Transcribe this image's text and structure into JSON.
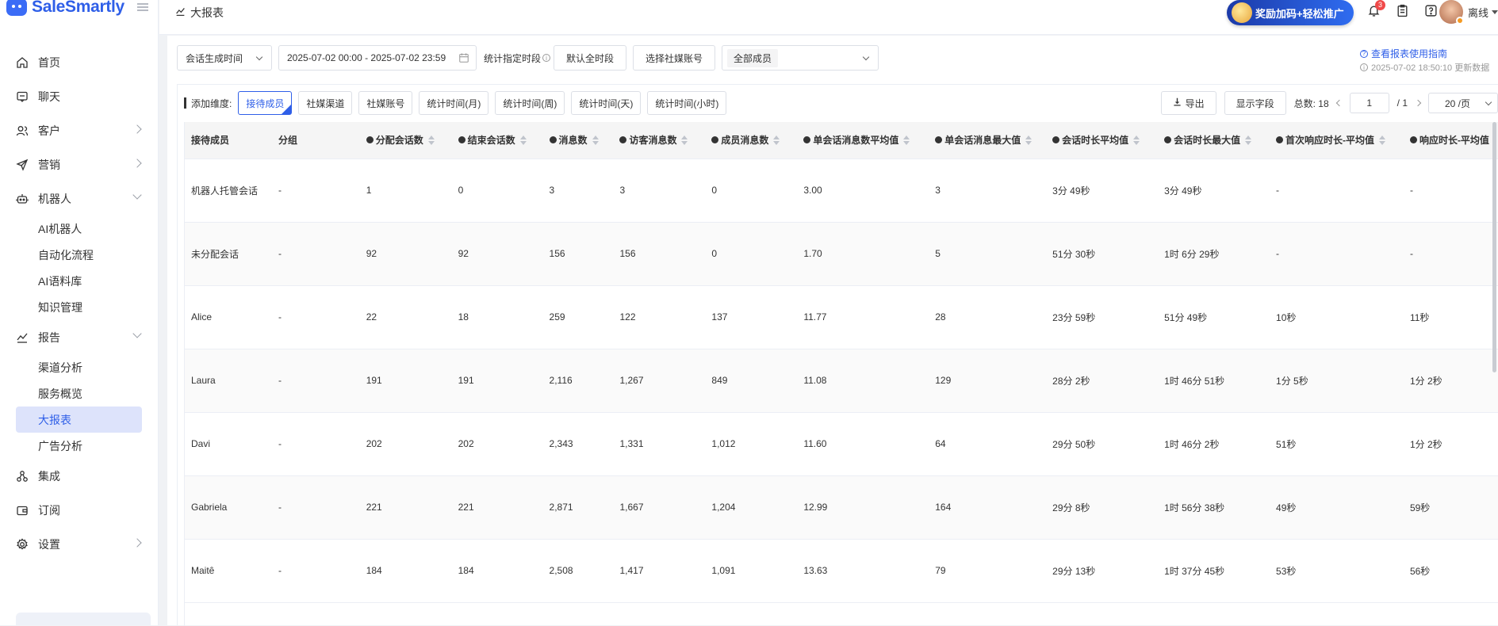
{
  "app": {
    "name": "SaleSmartly"
  },
  "sidebar": {
    "items": [
      {
        "label": "首页",
        "icon": "home-icon"
      },
      {
        "label": "聊天",
        "icon": "chat-icon"
      },
      {
        "label": "客户",
        "icon": "customers-icon"
      },
      {
        "label": "营销",
        "icon": "send-icon"
      },
      {
        "label": "机器人",
        "icon": "robot-icon"
      },
      {
        "label": "报告",
        "icon": "report-icon"
      },
      {
        "label": "集成",
        "icon": "integration-icon"
      },
      {
        "label": "订阅",
        "icon": "wallet-icon"
      },
      {
        "label": "设置",
        "icon": "gear-icon"
      }
    ],
    "robot_sub": [
      "AI机器人",
      "自动化流程",
      "AI语料库",
      "知识管理"
    ],
    "report_sub": [
      "渠道分析",
      "服务概览",
      "大报表",
      "广告分析"
    ]
  },
  "header": {
    "title": "大报表",
    "promo": "奖励加码+轻松推广",
    "notification_count": "3",
    "status": "离线"
  },
  "filters": {
    "time_type": "会话生成时间",
    "date_range": "2025-07-02 00:00 - 2025-07-02 23:59",
    "period_label": "统计指定时段",
    "default_period": "默认全时段",
    "select_account": "选择社媒账号",
    "members": "全部成员"
  },
  "guide": {
    "link": "查看报表使用指南",
    "updated": "2025-07-02 18:50:10 更新数据"
  },
  "dimensions": {
    "label": "添加维度:",
    "buttons": [
      "接待成员",
      "社媒渠道",
      "社媒账号",
      "统计时间(月)",
      "统计时间(周)",
      "统计时间(天)",
      "统计时间(小时)"
    ]
  },
  "toolbar": {
    "export": "导出",
    "fields": "显示字段",
    "total_label": "总数:",
    "total": "18",
    "page": "1",
    "pages": "/ 1",
    "page_size": "20 /页"
  },
  "table": {
    "headers": [
      "接待成员",
      "分组",
      "分配会话数",
      "结束会话数",
      "消息数",
      "访客消息数",
      "成员消息数",
      "单会话消息数平均值",
      "单会话消息最大值",
      "会话时长平均值",
      "会话时长最大值",
      "首次响应时长-平均值",
      "响应时长-平均值"
    ],
    "rows": [
      [
        "机器人托管会话",
        "-",
        "1",
        "0",
        "3",
        "3",
        "0",
        "3.00",
        "3",
        "3分 49秒",
        "3分 49秒",
        "-",
        "-"
      ],
      [
        "未分配会话",
        "-",
        "92",
        "92",
        "156",
        "156",
        "0",
        "1.70",
        "5",
        "51分 30秒",
        "1时 6分 29秒",
        "-",
        "-"
      ],
      [
        "Alice",
        "-",
        "22",
        "18",
        "259",
        "122",
        "137",
        "11.77",
        "28",
        "23分 59秒",
        "51分 49秒",
        "10秒",
        "11秒"
      ],
      [
        "Laura",
        "-",
        "191",
        "191",
        "2,116",
        "1,267",
        "849",
        "11.08",
        "129",
        "28分 2秒",
        "1时 46分 51秒",
        "1分 5秒",
        "1分 2秒"
      ],
      [
        "Davi",
        "-",
        "202",
        "202",
        "2,343",
        "1,331",
        "1,012",
        "11.60",
        "64",
        "29分 50秒",
        "1时 46分 2秒",
        "51秒",
        "1分 2秒"
      ],
      [
        "Gabriela",
        "-",
        "221",
        "221",
        "2,871",
        "1,667",
        "1,204",
        "12.99",
        "164",
        "29分 8秒",
        "1时 56分 38秒",
        "49秒",
        "59秒"
      ],
      [
        "Maitê",
        "-",
        "184",
        "184",
        "2,508",
        "1,417",
        "1,091",
        "13.63",
        "79",
        "29分 13秒",
        "1时 37分 45秒",
        "53秒",
        "56秒"
      ]
    ]
  }
}
